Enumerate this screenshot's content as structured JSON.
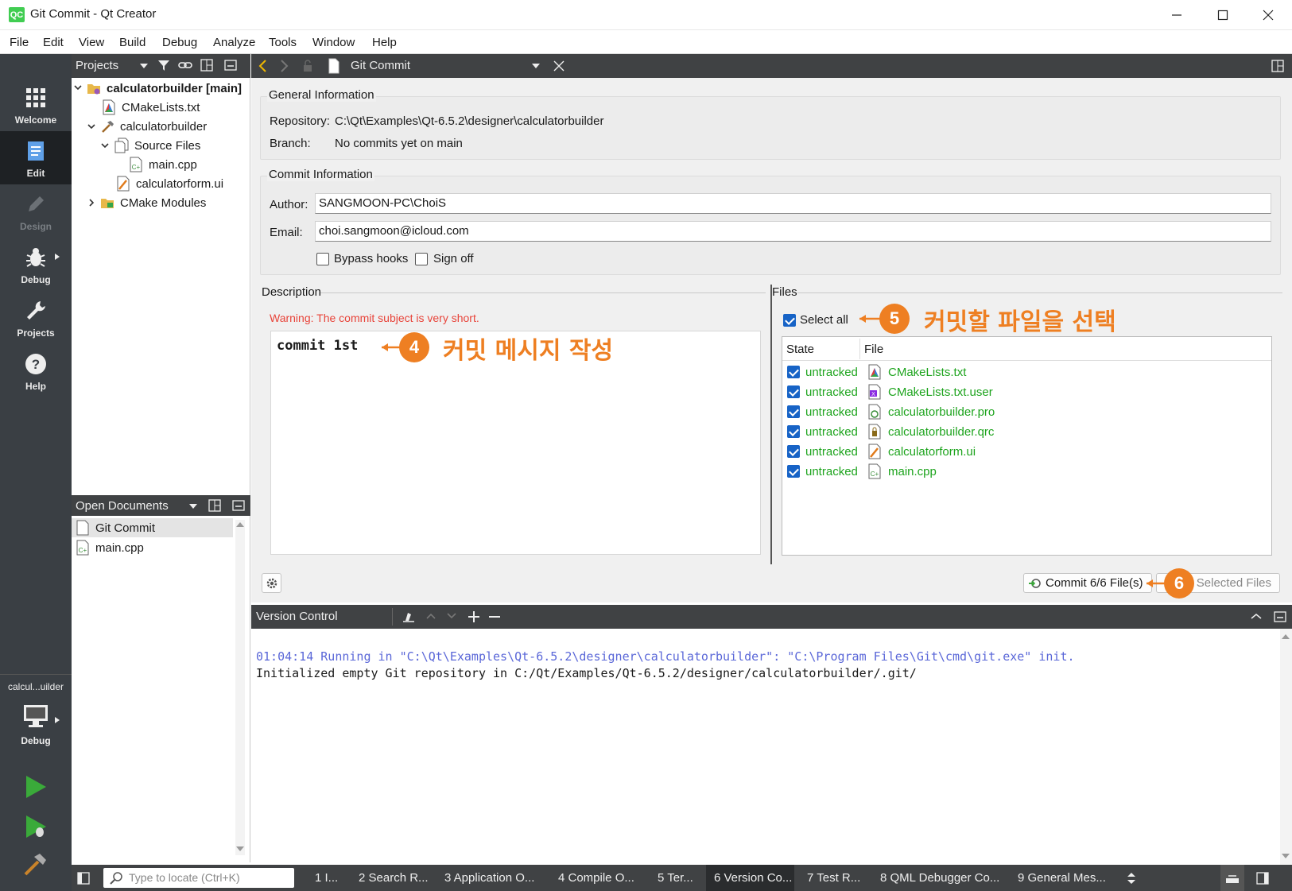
{
  "window": {
    "title": "Git Commit - Qt Creator",
    "logo": "QC"
  },
  "menu": [
    "File",
    "Edit",
    "View",
    "Build",
    "Debug",
    "Analyze",
    "Tools",
    "Window",
    "Help"
  ],
  "modes": [
    {
      "label": "Welcome",
      "icon": "grid-icon"
    },
    {
      "label": "Edit",
      "icon": "edit-icon"
    },
    {
      "label": "Design",
      "icon": "pencil-icon"
    },
    {
      "label": "Debug",
      "icon": "bug-icon"
    },
    {
      "label": "Projects",
      "icon": "wrench-icon"
    },
    {
      "label": "Help",
      "icon": "help-icon"
    }
  ],
  "kit": {
    "name": "calcul...uilder",
    "label": "Debug"
  },
  "projects_pane": {
    "title": "Projects"
  },
  "tree": [
    "calculatorbuilder [main]",
    "CMakeLists.txt",
    "calculatorbuilder",
    "Source Files",
    "main.cpp",
    "calculatorform.ui",
    "CMake Modules"
  ],
  "open_documents": {
    "title": "Open Documents",
    "items": [
      "Git Commit",
      "main.cpp"
    ]
  },
  "editor_tab": {
    "title": "Git Commit"
  },
  "general_info": {
    "title": "General Information",
    "repository_label": "Repository:",
    "repository": "C:\\Qt\\Examples\\Qt-6.5.2\\designer\\calculatorbuilder",
    "branch_label": "Branch:",
    "branch": "No commits yet on main"
  },
  "commit_info": {
    "title": "Commit Information",
    "author_label": "Author:",
    "author": "SANGMOON-PC\\ChoiS",
    "email_label": "Email:",
    "email": "choi.sangmoon@icloud.com",
    "bypass_hooks": "Bypass hooks",
    "sign_off": "Sign off"
  },
  "description": {
    "title": "Description",
    "warning": "Warning: The commit subject is very short.",
    "text": "commit 1st"
  },
  "files": {
    "title": "Files",
    "select_all": "Select all",
    "col_state": "State",
    "col_file": "File",
    "rows": [
      {
        "state": "untracked",
        "file": "CMakeLists.txt"
      },
      {
        "state": "untracked",
        "file": "CMakeLists.txt.user"
      },
      {
        "state": "untracked",
        "file": "calculatorbuilder.pro"
      },
      {
        "state": "untracked",
        "file": "calculatorbuilder.qrc"
      },
      {
        "state": "untracked",
        "file": "calculatorform.ui"
      },
      {
        "state": "untracked",
        "file": "main.cpp"
      }
    ]
  },
  "buttons": {
    "commit": "Commit 6/6 File(s)",
    "selected_files": "Selected Files"
  },
  "annotations": [
    {
      "num": "4",
      "text": "커밋 메시지 작성"
    },
    {
      "num": "5",
      "text": "커밋할 파일을 선택"
    },
    {
      "num": "6",
      "text": ""
    }
  ],
  "version_control": {
    "title": "Version Control",
    "line1": "01:04:14 Running in \"C:\\Qt\\Examples\\Qt-6.5.2\\designer\\calculatorbuilder\": \"C:\\Program Files\\Git\\cmd\\git.exe\" init.",
    "line2": "Initialized empty Git repository in C:/Qt/Examples/Qt-6.5.2/designer/calculatorbuilder/.git/"
  },
  "statusbar": {
    "locator_placeholder": "Type to locate (Ctrl+K)",
    "tabs": [
      "1  I...",
      "2  Search R...",
      "3  Application O...",
      "4  Compile O...",
      "5  Ter...",
      "6  Version Co...",
      "7  Test R...",
      "8  QML Debugger Co...",
      "9  General Mes..."
    ]
  },
  "colors": {
    "accent": "#ee7f22",
    "untracked": "#1ea41e",
    "warning": "#e8443a",
    "vc_blue": "#5a67d8"
  }
}
